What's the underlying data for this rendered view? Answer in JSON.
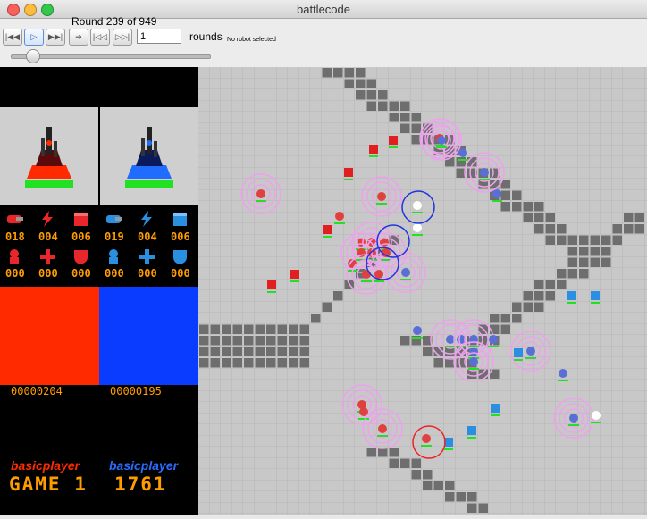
{
  "window": {
    "title": "battlecode"
  },
  "toolbar": {
    "round_status": "Round 239 of 949",
    "rounds_value": "1",
    "rounds_label": "rounds",
    "selection_status": "No robot selected",
    "buttons": [
      "rewind-icon",
      "play-icon",
      "step-forward-icon",
      "fast-forward-icon",
      "skip-back-icon",
      "skip-forward-icon"
    ]
  },
  "teams": {
    "red": {
      "color": "#ff2a00",
      "counts_top": [
        "018",
        "004",
        "006"
      ],
      "counts_bottom": [
        "000",
        "000",
        "000"
      ],
      "score": "00000204",
      "player": "basicplayer",
      "game_label": "GAME 1"
    },
    "blue": {
      "color": "#0a3cff",
      "counts_top": [
        "019",
        "004",
        "006"
      ],
      "counts_bottom": [
        "000",
        "000",
        "000"
      ],
      "score": "00000195",
      "player": "basicplayer",
      "game_label": "1761"
    }
  },
  "colors": {
    "map_bg": "#c8c8c8",
    "wall": "#6e6e6e",
    "grid": "#b4b4b4",
    "led": "#ff9d00"
  }
}
